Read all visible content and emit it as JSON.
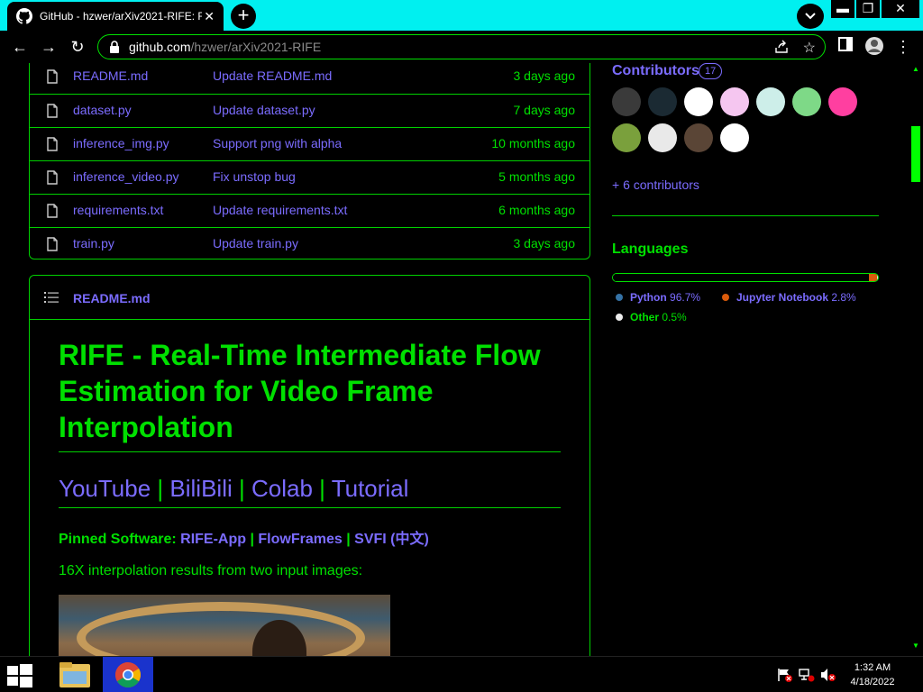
{
  "browser": {
    "tab_title": "GitHub - hzwer/arXiv2021-RIFE: RIFE",
    "url_domain": "github.com",
    "url_path": "/hzwer/arXiv2021-RIFE"
  },
  "files": [
    {
      "name": "README.md",
      "message": "Update README.md",
      "age": "3 days ago"
    },
    {
      "name": "dataset.py",
      "message": "Update dataset.py",
      "age": "7 days ago"
    },
    {
      "name": "inference_img.py",
      "message": "Support png with alpha",
      "age": "10 months ago"
    },
    {
      "name": "inference_video.py",
      "message": "Fix unstop bug",
      "age": "5 months ago"
    },
    {
      "name": "requirements.txt",
      "message": "Update requirements.txt",
      "age": "6 months ago"
    },
    {
      "name": "train.py",
      "message": "Update train.py",
      "age": "3 days ago"
    }
  ],
  "readme": {
    "filename": "README.md",
    "title": "RIFE - Real-Time Intermediate Flow Estimation for Video Frame Interpolation",
    "links": [
      "YouTube",
      "BiliBili",
      "Colab",
      "Tutorial"
    ],
    "separator": "|",
    "pinned_label": "Pinned Software:",
    "pinned_links": [
      "RIFE-App",
      "FlowFrames",
      "SVFI (中文)"
    ],
    "note": "16X interpolation results from two input images:"
  },
  "sidebar": {
    "contributors_title": "Contributors",
    "contributors_count": "17",
    "more_contributors": "+ 6 contributors",
    "languages_title": "Languages",
    "languages": [
      {
        "name": "Python",
        "percent": "96.7%",
        "value": 96.7,
        "color": "#3572A5"
      },
      {
        "name": "Jupyter Notebook",
        "percent": "2.8%",
        "value": 2.8,
        "color": "#DA5B0B"
      },
      {
        "name": "Other",
        "percent": "0.5%",
        "value": 0.5,
        "color": "#ededed"
      }
    ]
  },
  "taskbar": {
    "time": "1:32 AM",
    "date": "4/18/2022"
  },
  "colors": {
    "accent_green": "#00e000",
    "link_purple": "#7b6cff",
    "tabbar_cyan": "#00f0f0"
  }
}
